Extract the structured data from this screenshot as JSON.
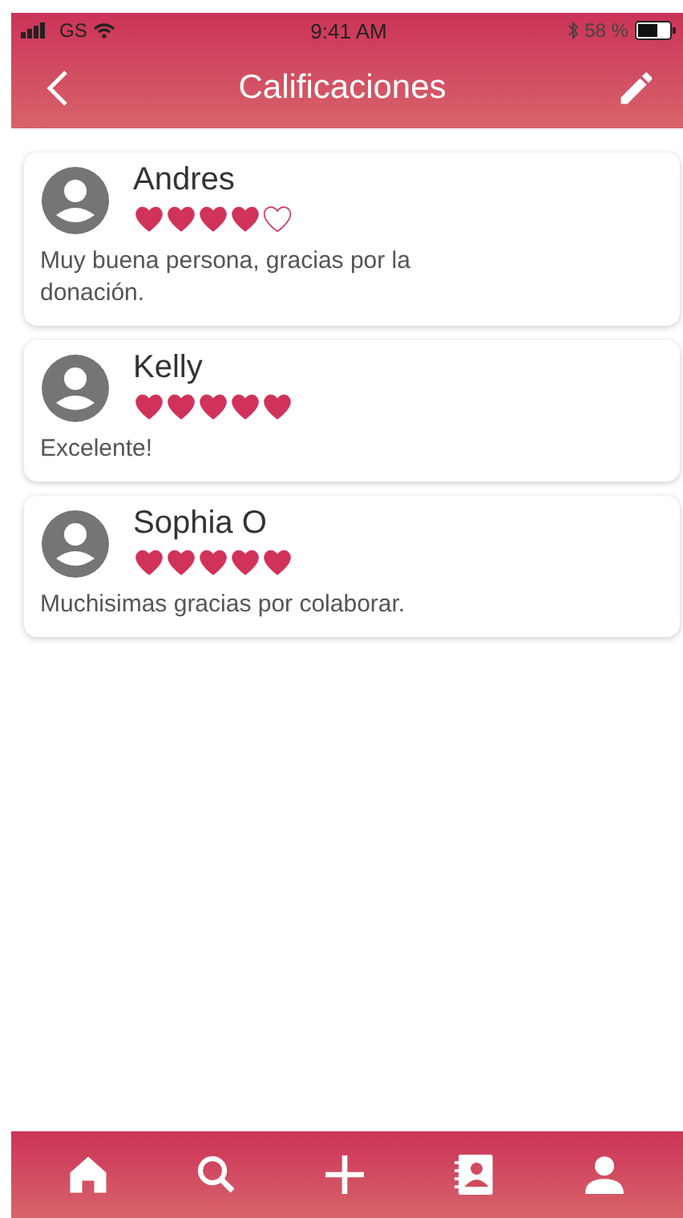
{
  "status_bar": {
    "carrier": "GS",
    "time": "9:41 AM",
    "battery_text": "58 %"
  },
  "header": {
    "title": "Calificaciones"
  },
  "reviews": [
    {
      "name": "Andres",
      "stars": 4,
      "comment": "Muy buena persona, gracias por la donación."
    },
    {
      "name": "Kelly",
      "stars": 5,
      "comment": "Excelente!"
    },
    {
      "name": "Sophia O",
      "stars": 5,
      "comment": "Muchisimas gracias por colaborar."
    }
  ],
  "tab_bar": [
    {
      "kind": "home"
    },
    {
      "kind": "search"
    },
    {
      "kind": "add"
    },
    {
      "kind": "contacts"
    },
    {
      "kind": "profile"
    }
  ]
}
